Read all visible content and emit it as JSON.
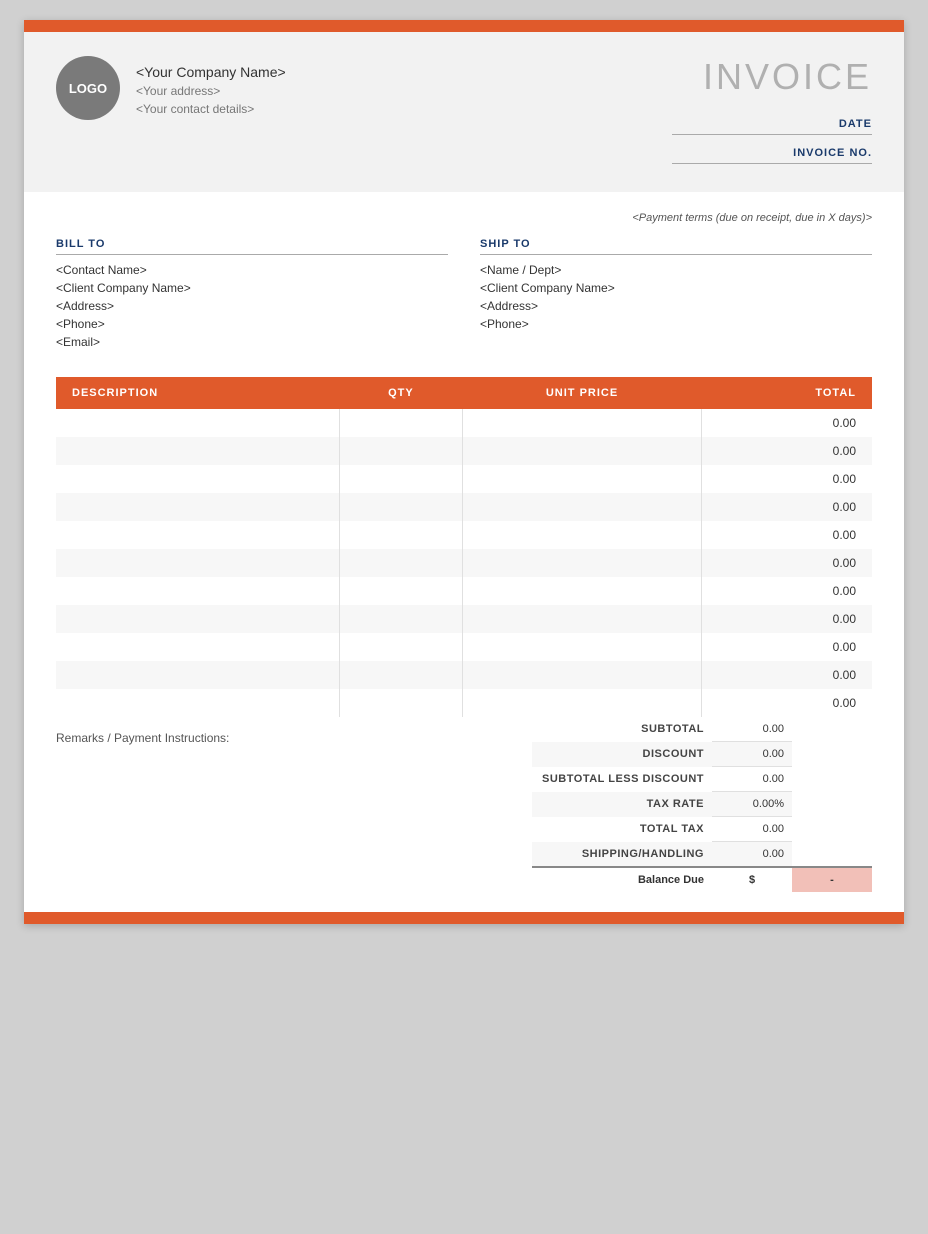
{
  "topBar": {
    "color": "#e05a2b"
  },
  "header": {
    "logo": {
      "label": "LOGO"
    },
    "companyName": "<Your Company Name>",
    "companyAddress": "<Your address>",
    "companyContact": "<Your contact details>",
    "invoiceTitle": "INVOICE",
    "dateLabelText": "DATE",
    "invoiceNoLabelText": "INVOICE NO."
  },
  "paymentTerms": "<Payment terms (due on receipt, due in X days)>",
  "billTo": {
    "label": "BILL TO",
    "contactName": "<Contact Name>",
    "clientCompanyName": "<Client Company Name>",
    "address": "<Address>",
    "phone": "<Phone>",
    "email": "<Email>"
  },
  "shipTo": {
    "label": "SHIP TO",
    "nameDept": "<Name / Dept>",
    "clientCompanyName": "<Client Company Name>",
    "address": "<Address>",
    "phone": "<Phone>"
  },
  "table": {
    "columns": [
      "DESCRIPTION",
      "QTY",
      "UNIT PRICE",
      "TOTAL"
    ],
    "rows": [
      {
        "desc": "",
        "qty": "",
        "unitPrice": "",
        "total": "0.00"
      },
      {
        "desc": "",
        "qty": "",
        "unitPrice": "",
        "total": "0.00"
      },
      {
        "desc": "",
        "qty": "",
        "unitPrice": "",
        "total": "0.00"
      },
      {
        "desc": "",
        "qty": "",
        "unitPrice": "",
        "total": "0.00"
      },
      {
        "desc": "",
        "qty": "",
        "unitPrice": "",
        "total": "0.00"
      },
      {
        "desc": "",
        "qty": "",
        "unitPrice": "",
        "total": "0.00"
      },
      {
        "desc": "",
        "qty": "",
        "unitPrice": "",
        "total": "0.00"
      },
      {
        "desc": "",
        "qty": "",
        "unitPrice": "",
        "total": "0.00"
      },
      {
        "desc": "",
        "qty": "",
        "unitPrice": "",
        "total": "0.00"
      },
      {
        "desc": "",
        "qty": "",
        "unitPrice": "",
        "total": "0.00"
      },
      {
        "desc": "",
        "qty": "",
        "unitPrice": "",
        "total": "0.00"
      }
    ]
  },
  "totals": {
    "remarksLabel": "Remarks / Payment Instructions:",
    "subtotalLabel": "SUBTOTAL",
    "subtotalValue": "0.00",
    "discountLabel": "DISCOUNT",
    "discountValue": "0.00",
    "subtotalLessDiscountLabel": "SUBTOTAL LESS DISCOUNT",
    "subtotalLessDiscountValue": "0.00",
    "taxRateLabel": "TAX RATE",
    "taxRateValue": "0.00%",
    "totalTaxLabel": "TOTAL TAX",
    "totalTaxValue": "0.00",
    "shippingLabel": "SHIPPING/HANDLING",
    "shippingValue": "0.00",
    "balanceDueLabel": "Balance Due",
    "balanceCurrency": "$",
    "balanceValue": "-"
  }
}
